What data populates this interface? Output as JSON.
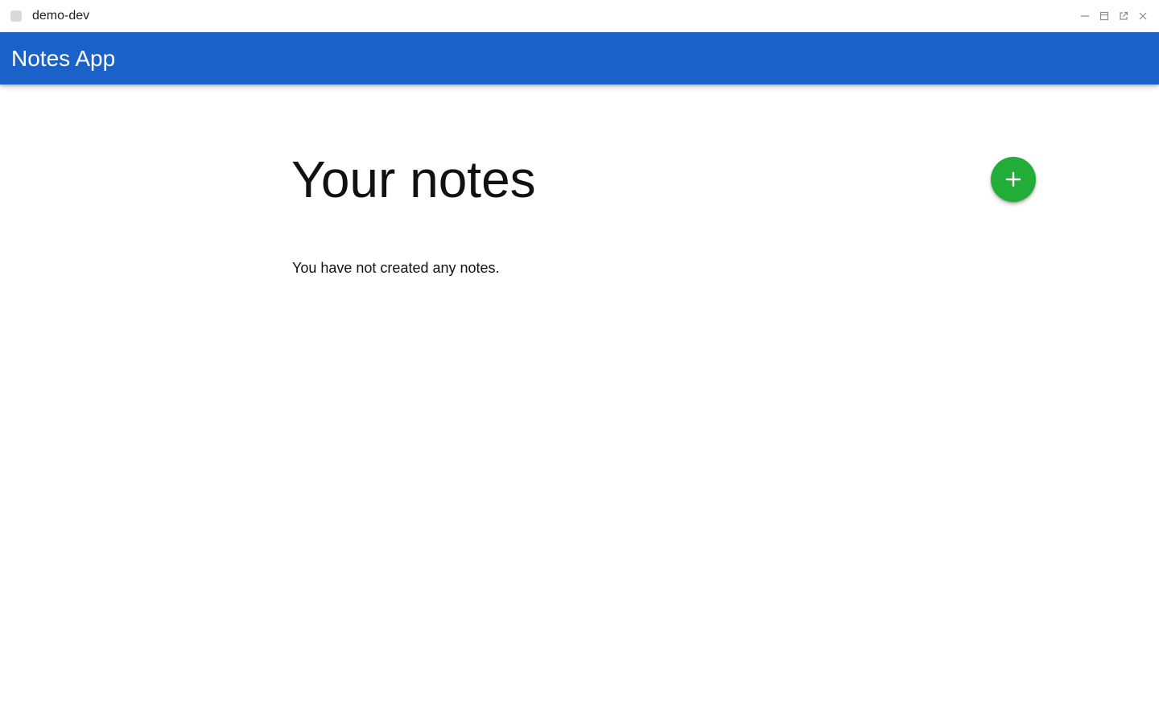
{
  "window": {
    "title": "demo-dev",
    "controls": [
      {
        "icon": "minimize-icon"
      },
      {
        "icon": "maximize-icon"
      },
      {
        "icon": "pop-out-icon"
      },
      {
        "icon": "close-icon"
      }
    ]
  },
  "app_bar": {
    "title": "Notes App",
    "color": "#1a62c8"
  },
  "main": {
    "heading": "Your notes",
    "empty_message": "You have not created any notes.",
    "add_button": {
      "icon": "plus-icon",
      "color": "#22ac38"
    }
  }
}
